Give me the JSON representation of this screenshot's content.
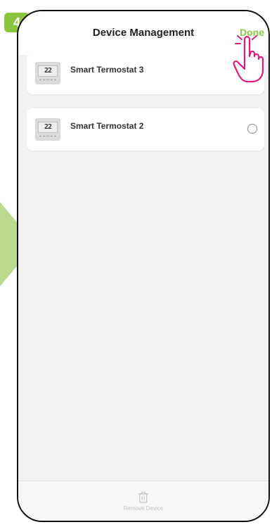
{
  "step": {
    "number": "4"
  },
  "header": {
    "title": "Device Management",
    "done_label": "Done"
  },
  "devices": [
    {
      "name": "Smart Termostat 3",
      "display": "22"
    },
    {
      "name": "Smart Termostat 2",
      "display": "22"
    }
  ],
  "footer": {
    "remove_label": "Remove Device"
  },
  "colors": {
    "accent": "#8cc63f",
    "hand": "#e0197d"
  },
  "icons": {
    "trash": "trash-icon",
    "pointer": "hand-pointer-icon",
    "arrow": "arrow-right-icon"
  }
}
